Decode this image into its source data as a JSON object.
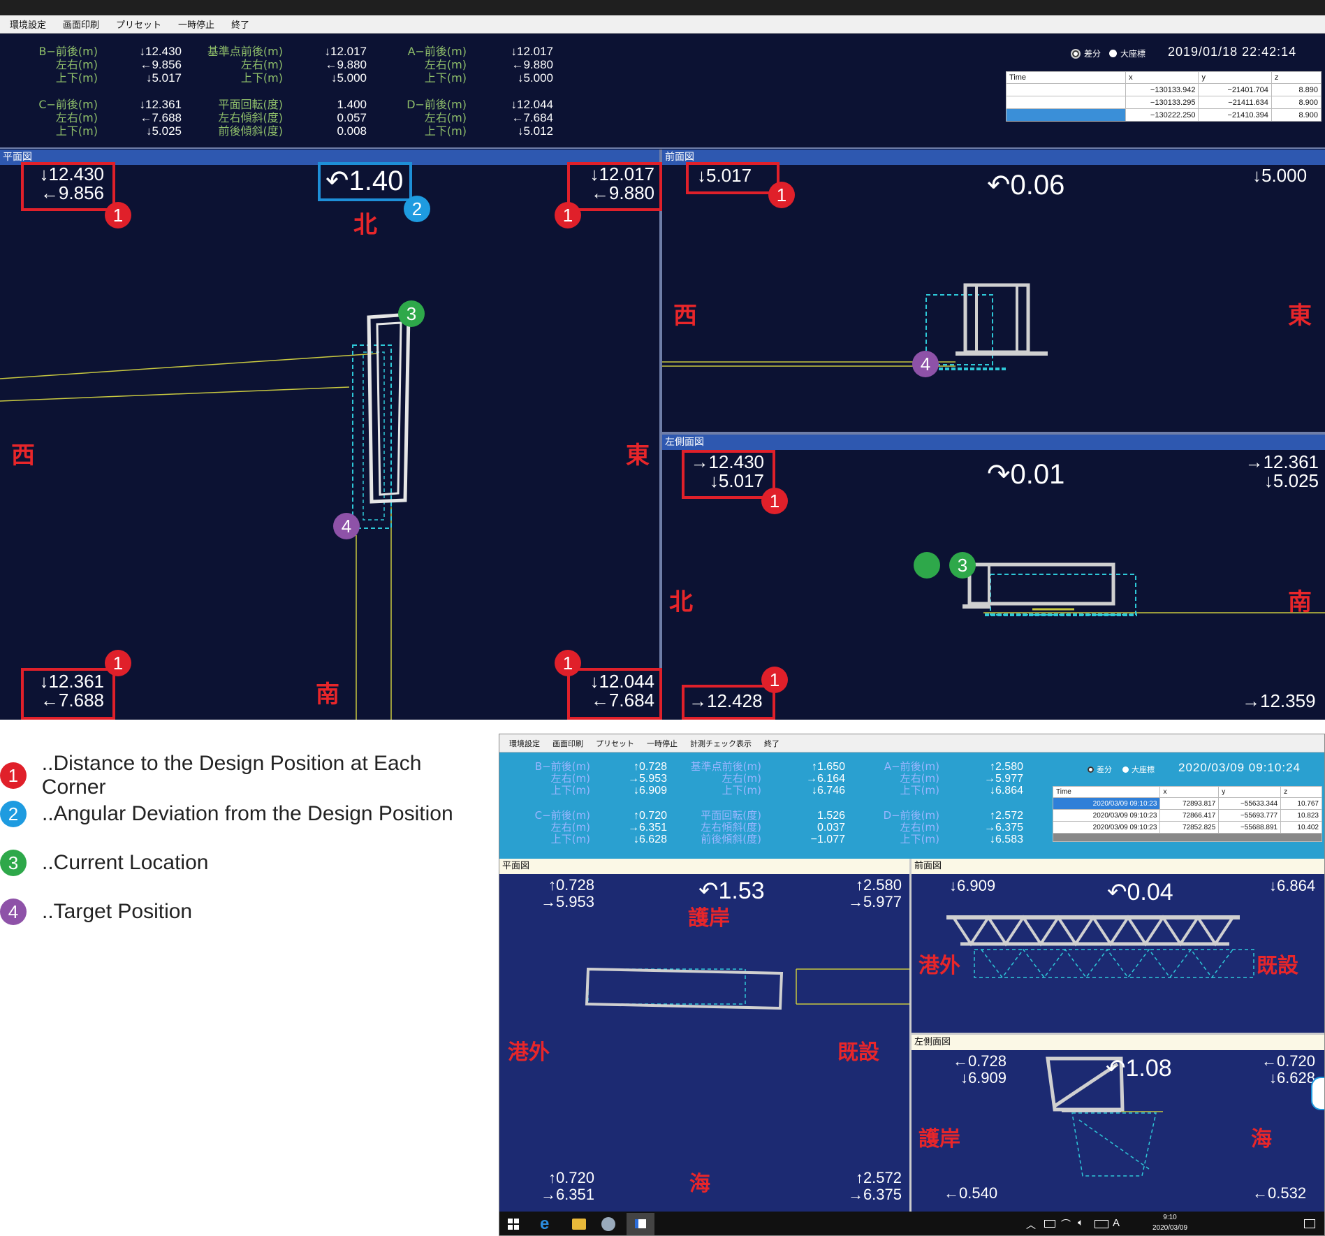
{
  "screen1": {
    "menu": [
      "環境設定",
      "画面印刷",
      "プリセット",
      "一時停止",
      "終了"
    ],
    "header": {
      "B_labels": "B−前後(m)\n左右(m)\n上下(m)",
      "B_values": "↓12.430\n←9.856\n↓5.017",
      "ref_labels": "基準点前後(m)\n左右(m)\n上下(m)",
      "ref_values": "↓12.017\n←9.880\n↓5.000",
      "A_labels": "A−前後(m)\n左右(m)\n上下(m)",
      "A_values": "↓12.017\n←9.880\n↓5.000",
      "C_labels": "C−前後(m)\n左右(m)\n上下(m)",
      "C_values": "↓12.361\n←7.688\n↓5.025",
      "rot_labels": "平面回転(度)\n左右傾斜(度)\n前後傾斜(度)",
      "rot_values": "1.400\n0.057\n0.008",
      "D_labels": "D−前後(m)\n左右(m)\n上下(m)",
      "D_values": "↓12.044\n←7.684\n↓5.012",
      "radio1": "差分",
      "radio2": "大座標",
      "datetime": "2019/01/18 22:42:14",
      "table_head": [
        "Time",
        "x",
        "y",
        "z"
      ],
      "table_rows": [
        [
          "",
          "−130133.942",
          "−21401.704",
          "8.890"
        ],
        [
          "",
          "−130133.295",
          "−21411.634",
          "8.900"
        ],
        [
          "",
          "−130222.250",
          "−21410.394",
          "8.900"
        ]
      ]
    },
    "plan": {
      "title": "平面図",
      "tl": "↓12.430\n←9.856",
      "tr": "↓12.017\n←9.880",
      "bl": "↓12.361\n←7.688",
      "br": "↓12.044\n←7.684",
      "angle": "↶1.40",
      "north": "北",
      "west": "西",
      "east": "東",
      "south": "南"
    },
    "front": {
      "title": "前面図",
      "tl": "↓5.017",
      "tr": "↓5.000",
      "angle": "↶0.06",
      "west": "西",
      "east": "東"
    },
    "side": {
      "title": "左側面図",
      "tl": "→12.430\n↓5.017",
      "tr": "→12.361\n↓5.025",
      "bl": "→12.428",
      "br": "→12.359",
      "angle": "↷0.01",
      "north": "北",
      "south": "南"
    }
  },
  "legend": [
    {
      "num": "1",
      "color": "#e0202a",
      "text": "..Distance to the Design Position at Each Corner"
    },
    {
      "num": "2",
      "color": "#1e9be0",
      "text": "..Angular Deviation from the Design Position"
    },
    {
      "num": "3",
      "color": "#2ea84a",
      "text": "..Current Location"
    },
    {
      "num": "4",
      "color": "#8e52a8",
      "text": "..Target Position"
    }
  ],
  "screen2": {
    "menu": [
      "環境設定",
      "画面印刷",
      "プリセット",
      "一時停止",
      "計測チェック表示",
      "終了"
    ],
    "header": {
      "B_labels": "B−前後(m)\n左右(m)\n上下(m)",
      "B_values": "↑0.728\n→5.953\n↓6.909",
      "ref_labels": "基準点前後(m)\n左右(m)\n上下(m)",
      "ref_values": "↑1.650\n→6.164\n↓6.746",
      "A_labels": "A−前後(m)\n左右(m)\n上下(m)",
      "A_values": "↑2.580\n→5.977\n↓6.864",
      "C_labels": "C−前後(m)\n左右(m)\n上下(m)",
      "C_values": "↑0.720\n→6.351\n↓6.628",
      "rot_labels": "平面回転(度)\n左右傾斜(度)\n前後傾斜(度)",
      "rot_values": "1.526\n0.037\n−1.077",
      "D_labels": "D−前後(m)\n左右(m)\n上下(m)",
      "D_values": "↑2.572\n→6.375\n↓6.583",
      "radio1": "差分",
      "radio2": "大座標",
      "datetime": "2020/03/09 09:10:24",
      "table_head": [
        "Time",
        "x",
        "y",
        "z"
      ],
      "table_rows": [
        [
          "2020/03/09 09:10:23",
          "72893.817",
          "−55633.344",
          "10.767"
        ],
        [
          "2020/03/09 09:10:23",
          "72866.417",
          "−55693.777",
          "10.823"
        ],
        [
          "2020/03/09 09:10:23",
          "72852.825",
          "−55688.891",
          "10.402"
        ]
      ]
    },
    "plan": {
      "title": "平面図",
      "tl": "↑0.728\n→5.953",
      "tr": "↑2.580\n→5.977",
      "bl": "↑0.720\n→6.351",
      "br": "↑2.572\n→6.375",
      "angle": "↶1.53",
      "top": "護岸",
      "left": "港外",
      "right": "既設",
      "bottom": "海"
    },
    "front": {
      "title": "前面図",
      "tl": "↓6.909",
      "tr": "↓6.864",
      "angle": "↶0.04",
      "left": "港外",
      "right": "既設"
    },
    "side": {
      "title": "左側面図",
      "tl": "←0.728\n↓6.909",
      "tr": "←0.720\n↓6.628",
      "bl": "←0.540",
      "br": "←0.532",
      "angle": "↶1.08",
      "left": "護岸",
      "right": "海"
    },
    "taskbar": {
      "time": "9:10",
      "date": "2020/03/09",
      "ime": "A"
    }
  }
}
